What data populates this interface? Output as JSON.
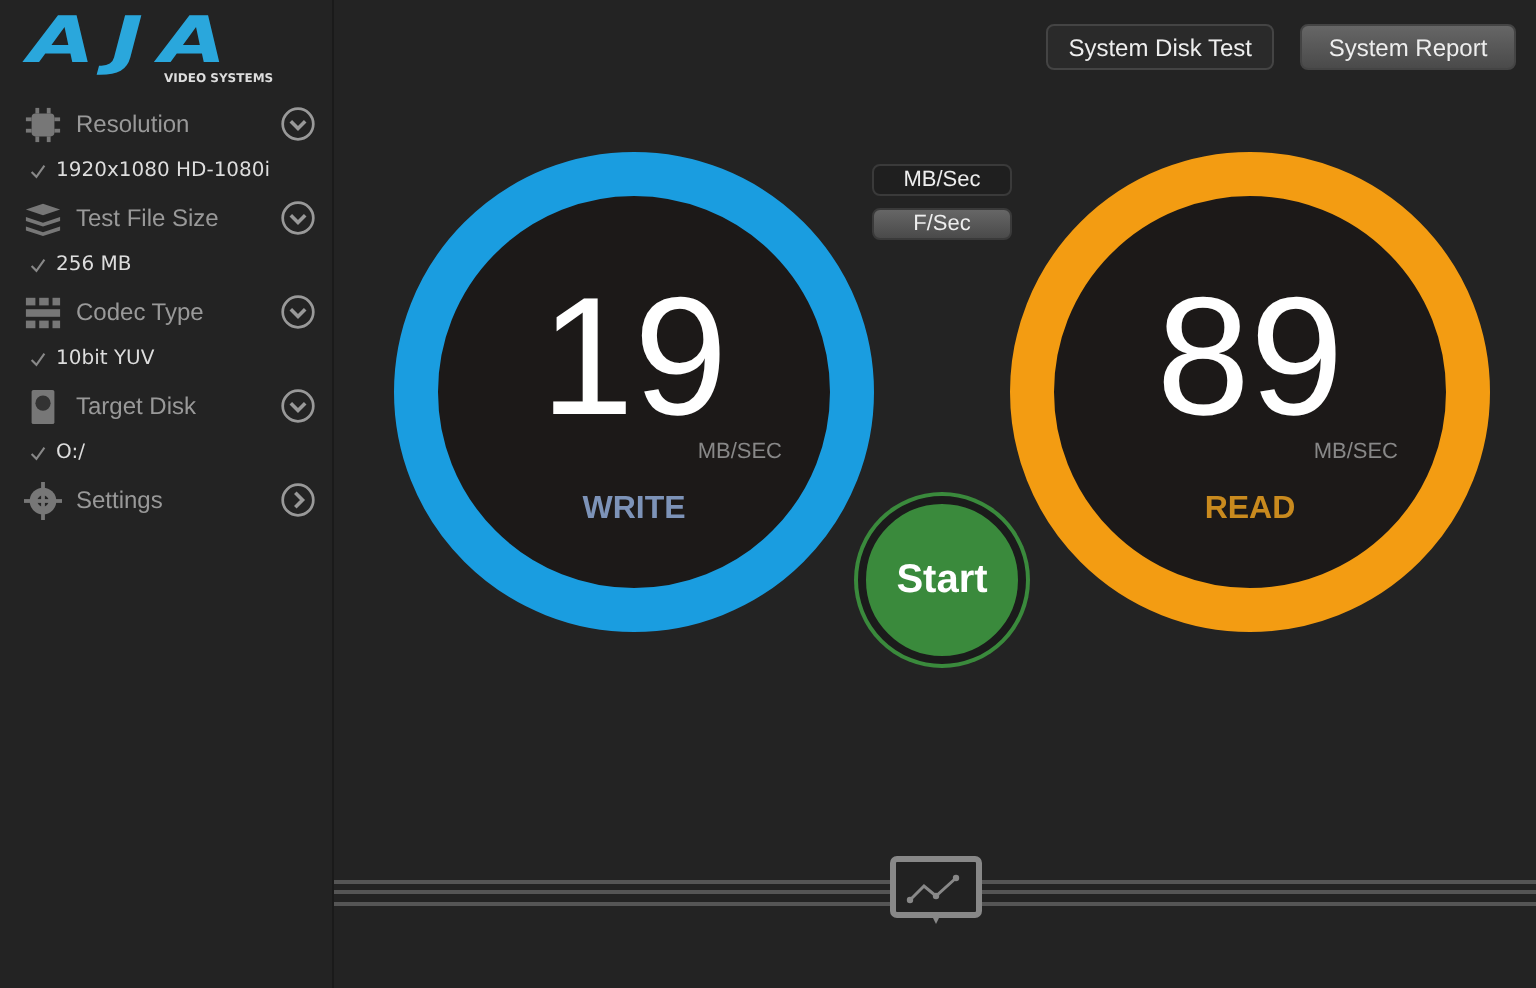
{
  "logo": {
    "mark": "AJA",
    "tagline": "VIDEO SYSTEMS"
  },
  "sidebar": {
    "items": [
      {
        "label": "Resolution",
        "value": "1920x1080 HD-1080i",
        "kind": "dropdown"
      },
      {
        "label": "Test File Size",
        "value": "256 MB",
        "kind": "dropdown"
      },
      {
        "label": "Codec Type",
        "value": "10bit YUV",
        "kind": "dropdown"
      },
      {
        "label": "Target Disk",
        "value": "O:/",
        "kind": "dropdown"
      },
      {
        "label": "Settings",
        "kind": "link"
      }
    ]
  },
  "toolbar": {
    "buttons": [
      "System Disk Test",
      "System Report"
    ]
  },
  "units": [
    {
      "label": "MB/Sec",
      "selected": false
    },
    {
      "label": "F/Sec",
      "selected": true
    }
  ],
  "gauges": [
    {
      "value": "19",
      "unit": "MB/SEC",
      "label": "WRITE",
      "color": "#1a9de0"
    },
    {
      "value": "89",
      "unit": "MB/SEC",
      "label": "READ",
      "color": "#f39c12"
    }
  ],
  "start_button": "Start"
}
